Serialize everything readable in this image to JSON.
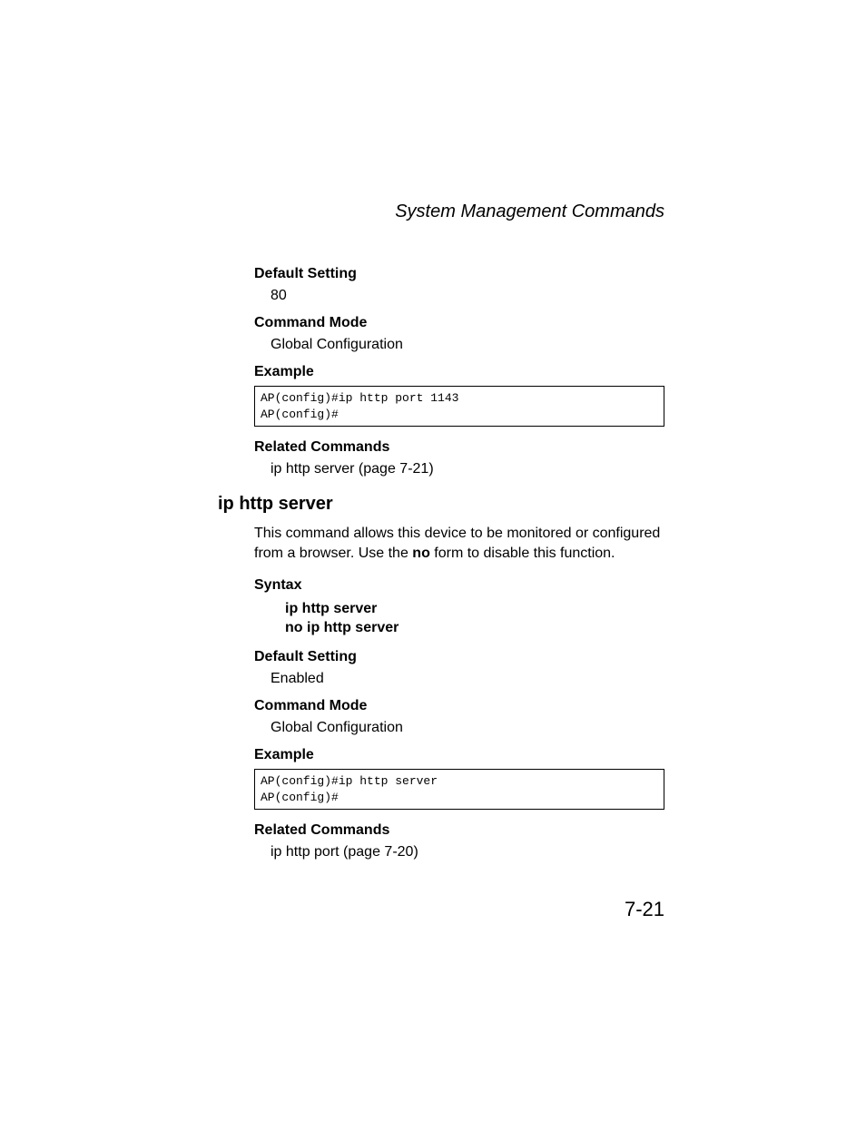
{
  "header": {
    "title": "System Management Commands"
  },
  "section1": {
    "default_setting_label": "Default Setting",
    "default_setting_value": "80",
    "command_mode_label": "Command Mode",
    "command_mode_value": "Global Configuration",
    "example_label": "Example",
    "example_code": "AP(config)#ip http port 1143\nAP(config)#",
    "related_commands_label": "Related Commands",
    "related_commands_value": "ip http server (page 7-21)"
  },
  "section2": {
    "heading": "ip http server",
    "description_part1": "This command allows this device to be monitored or configured from a browser. Use the ",
    "description_bold": "no",
    "description_part2": " form to disable this function.",
    "syntax_label": "Syntax",
    "syntax_line1": "ip http server",
    "syntax_line2": "no ip http server",
    "default_setting_label": "Default Setting",
    "default_setting_value": "Enabled",
    "command_mode_label": "Command Mode",
    "command_mode_value": "Global Configuration",
    "example_label": "Example",
    "example_code": "AP(config)#ip http server\nAP(config)#",
    "related_commands_label": "Related Commands",
    "related_commands_value": "ip http port (page 7-20)"
  },
  "page_number": "7-21"
}
